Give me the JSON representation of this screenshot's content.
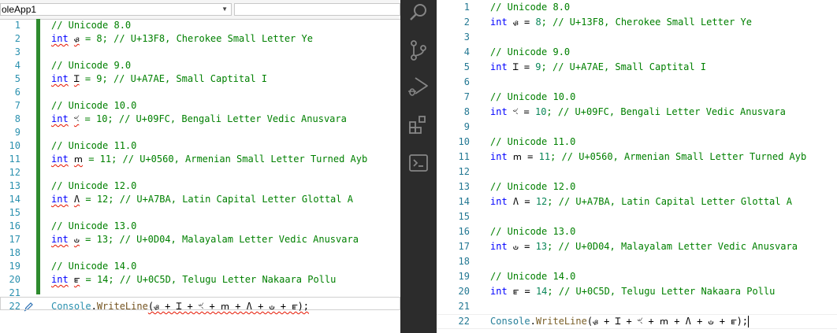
{
  "vs": {
    "project_dropdown": "oleApp1",
    "line_numbers": [
      "1",
      "2",
      "3",
      "4",
      "5",
      "6",
      "7",
      "8",
      "9",
      "10",
      "11",
      "12",
      "13",
      "14",
      "15",
      "16",
      "17",
      "18",
      "19",
      "20",
      "21",
      "22"
    ],
    "code": {
      "c8": "// Unicode 8.0",
      "l2_kw": "int",
      "l2_var": "ᏸ",
      "l2_rest": " = 8; // U+13F8, Cherokee Small Letter Ye",
      "c9": "// Unicode 9.0",
      "l5_kw": "int",
      "l5_var": "Ɪ",
      "l5_rest": " = 9; // U+A7AE, Small Captital I",
      "c10": "// Unicode 10.0",
      "l8_kw": "int",
      "l8_var": "ৼ",
      "l8_rest": " = 10; // U+09FC, Bengali Letter Vedic Anusvara",
      "c11": "// Unicode 11.0",
      "l11_kw": "int",
      "l11_var": "ՠ",
      "l11_rest": " = 11; // U+0560, Armenian Small Letter Turned Ayb",
      "c12": "// Unicode 12.0",
      "l14_kw": "int",
      "l14_var": "Ʌ",
      "l14_rest": " = 12; // U+A7BA, Latin Capital Letter Glottal A",
      "c13": "// Unicode 13.0",
      "l17_kw": "int",
      "l17_var": "ഄ",
      "l17_rest": " = 13; // U+0D04, Malayalam Letter Vedic Anusvara",
      "c14": "// Unicode 14.0",
      "l20_kw": "int",
      "l20_var": "ౝ",
      "l20_rest": " = 14; // U+0C5D, Telugu Letter Nakaara Pollu",
      "l22_class": "Console",
      "l22_dot": ".",
      "l22_method": "WriteLine",
      "l22_args": "(ᏸ + Ɪ + ৼ + ՠ + Ʌ + ഄ + ౝ);"
    }
  },
  "activity_bar": {
    "icons": [
      "search-icon",
      "source-control-icon",
      "run-debug-icon",
      "extensions-icon",
      "terminal-icon"
    ],
    "bg_color": "#2c2c2c"
  },
  "vscode": {
    "line_numbers": [
      "1",
      "2",
      "3",
      "4",
      "5",
      "6",
      "7",
      "8",
      "9",
      "10",
      "11",
      "12",
      "13",
      "14",
      "15",
      "16",
      "17",
      "18",
      "19",
      "20",
      "21",
      "22"
    ],
    "code": {
      "c8": "// Unicode 8.0",
      "l2_kw": "int",
      "l2_var": " ᏸ",
      "l2_eq": " = ",
      "l2_num": "8",
      "l2_cm": "; // U+13F8, Cherokee Small Letter Ye",
      "c9": "// Unicode 9.0",
      "l5_kw": "int",
      "l5_var": " Ɪ",
      "l5_eq": " = ",
      "l5_num": "9",
      "l5_cm": "; // U+A7AE, Small Captital I",
      "c10": "// Unicode 10.0",
      "l8_kw": "int",
      "l8_var": " ৼ",
      "l8_eq": " = ",
      "l8_num": "10",
      "l8_cm": "; // U+09FC, Bengali Letter Vedic Anusvara",
      "c11": "// Unicode 11.0",
      "l11_kw": "int",
      "l11_var": " ՠ",
      "l11_eq": " = ",
      "l11_num": "11",
      "l11_cm": "; // U+0560, Armenian Small Letter Turned Ayb",
      "c12": "// Unicode 12.0",
      "l14_kw": "int",
      "l14_var": " Ʌ",
      "l14_eq": " = ",
      "l14_num": "12",
      "l14_cm": "; // U+A7BA, Latin Capital Letter Glottal A",
      "c13": "// Unicode 13.0",
      "l17_kw": "int",
      "l17_var": " ഄ",
      "l17_eq": " = ",
      "l17_num": "13",
      "l17_cm": "; // U+0D04, Malayalam Letter Vedic Anusvara",
      "c14": "// Unicode 14.0",
      "l20_kw": "int",
      "l20_var": " ౝ",
      "l20_eq": " = ",
      "l20_num": "14",
      "l20_cm": "; // U+0C5D, Telugu Letter Nakaara Pollu",
      "l22_class": "Console",
      "l22_dot": ".",
      "l22_method": "WriteLine",
      "l22_args": "(ᏸ + Ɪ + ৼ + ՠ + Ʌ + ഄ + ౝ);"
    }
  }
}
